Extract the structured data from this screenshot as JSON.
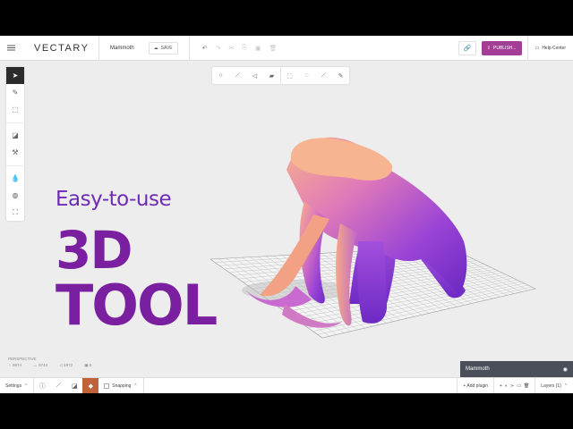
{
  "app": {
    "logo": "VECTARY",
    "project_name": "Mammoth"
  },
  "topbar": {
    "save_label": "SAVE",
    "publish_label": "PUBLISH...",
    "help_label": "Help Center",
    "icons": [
      "undo-icon",
      "redo-icon",
      "cut-icon",
      "copy-icon",
      "paste-icon",
      "delete-icon"
    ]
  },
  "left_toolbar": [
    "select-icon",
    "pen-icon",
    "cube-icon",
    "material-icon",
    "hammer-icon",
    "drop-icon",
    "sphere-icon",
    "frame-icon"
  ],
  "float_toolbar": [
    "vertex-icon",
    "edge-icon",
    "face-icon",
    "object-icon",
    "rect-select-icon",
    "lasso-icon",
    "brush-select-icon",
    "paint-icon"
  ],
  "hero": {
    "subtitle": "Easy-to-use",
    "line1": "3D",
    "line2": "TOOL"
  },
  "viewport": {
    "camera_label": "PERSPECTIVE",
    "stats": [
      "8874",
      "9744",
      "4872",
      "8"
    ]
  },
  "layers_panel": {
    "title": "Mammoth"
  },
  "bottombar": {
    "settings_label": "Settings",
    "snapping_label": "Snapping",
    "add_plugin_label": "+ Add plugin",
    "layers_label": "Layers (1)"
  },
  "colors": {
    "accent": "#a33d96",
    "hero_purple": "#7a1fa0",
    "mammoth_pink": "#f5a58a",
    "mammoth_violet": "#8a3ad0"
  }
}
